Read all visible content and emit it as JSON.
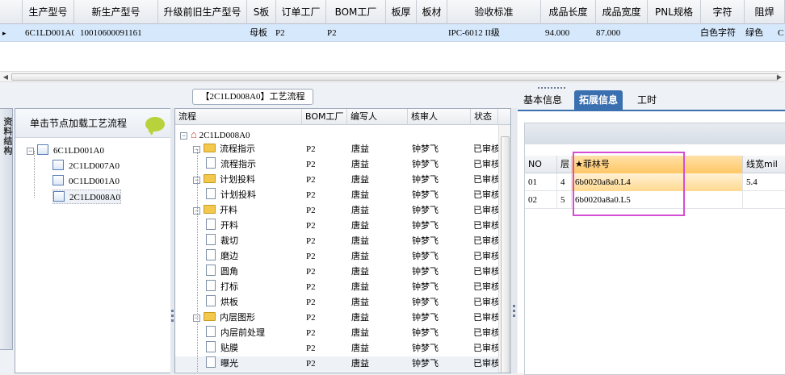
{
  "top_grid": {
    "columns": [
      "生产型号",
      "新生产型号",
      "升级前旧生产型号",
      "S板",
      "订单工厂",
      "BOM工厂",
      "板厚",
      "板材",
      "验收标准",
      "成品长度",
      "成品宽度",
      "PNL规格",
      "字符",
      "阻焊"
    ],
    "row": {
      "marker": "▸",
      "prod_model": "6C1LD001A0",
      "new_model": "10010600091161",
      "old_model": "",
      "s_board": "母板",
      "order_factory": "P2",
      "bom_factory": "P2",
      "thickness": "",
      "material": "",
      "standard": "IPC-6012 II级",
      "length": "94.000",
      "width": "87.000",
      "pnl": "",
      "char": "白色字符",
      "solder": "绿色",
      "extra": "C"
    }
  },
  "left_vertical_tab": "资料结构",
  "tree": {
    "header": "单击节点加载工艺流程",
    "root": "6C1LD001A0",
    "children": [
      "2C1LD007A0",
      "0C1LD001A0",
      "2C1LD008A0"
    ],
    "selected": "2C1LD008A0"
  },
  "flow": {
    "title": "【2C1LD008A0】工艺流程",
    "columns": [
      "流程",
      "BOM工厂",
      "编写人",
      "核审人",
      "状态"
    ],
    "root": "2C1LD008A0",
    "rows": [
      {
        "name": "流程指示",
        "level": 1,
        "folder": true,
        "bom": "P2",
        "writer": "唐益",
        "reviewer": "钟梦飞",
        "status": "已审核"
      },
      {
        "name": "流程指示",
        "level": 2,
        "folder": false,
        "bom": "P2",
        "writer": "唐益",
        "reviewer": "钟梦飞",
        "status": "已审核"
      },
      {
        "name": "计划投料",
        "level": 1,
        "folder": true,
        "bom": "P2",
        "writer": "唐益",
        "reviewer": "钟梦飞",
        "status": "已审核"
      },
      {
        "name": "计划投料",
        "level": 2,
        "folder": false,
        "bom": "P2",
        "writer": "唐益",
        "reviewer": "钟梦飞",
        "status": "已审核"
      },
      {
        "name": "开料",
        "level": 1,
        "folder": true,
        "bom": "P2",
        "writer": "唐益",
        "reviewer": "钟梦飞",
        "status": "已审核"
      },
      {
        "name": "开料",
        "level": 2,
        "folder": false,
        "bom": "P2",
        "writer": "唐益",
        "reviewer": "钟梦飞",
        "status": "已审核"
      },
      {
        "name": "裁切",
        "level": 2,
        "folder": false,
        "bom": "P2",
        "writer": "唐益",
        "reviewer": "钟梦飞",
        "status": "已审核"
      },
      {
        "name": "磨边",
        "level": 2,
        "folder": false,
        "bom": "P2",
        "writer": "唐益",
        "reviewer": "钟梦飞",
        "status": "已审核"
      },
      {
        "name": "圆角",
        "level": 2,
        "folder": false,
        "bom": "P2",
        "writer": "唐益",
        "reviewer": "钟梦飞",
        "status": "已审核"
      },
      {
        "name": "打标",
        "level": 2,
        "folder": false,
        "bom": "P2",
        "writer": "唐益",
        "reviewer": "钟梦飞",
        "status": "已审核"
      },
      {
        "name": "烘板",
        "level": 2,
        "folder": false,
        "bom": "P2",
        "writer": "唐益",
        "reviewer": "钟梦飞",
        "status": "已审核"
      },
      {
        "name": "内层图形",
        "level": 1,
        "folder": true,
        "bom": "P2",
        "writer": "唐益",
        "reviewer": "钟梦飞",
        "status": "已审核"
      },
      {
        "name": "内层前处理",
        "level": 2,
        "folder": false,
        "bom": "P2",
        "writer": "唐益",
        "reviewer": "钟梦飞",
        "status": "已审核"
      },
      {
        "name": "贴膜",
        "level": 2,
        "folder": false,
        "bom": "P2",
        "writer": "唐益",
        "reviewer": "钟梦飞",
        "status": "已审核"
      },
      {
        "name": "曝光",
        "level": 2,
        "folder": false,
        "bom": "P2",
        "writer": "唐益",
        "reviewer": "钟梦飞",
        "status": "已审核"
      }
    ]
  },
  "right": {
    "tabs": [
      "基本信息",
      "拓展信息",
      "工时"
    ],
    "active_tab": "拓展信息",
    "columns": [
      "NO",
      "层",
      "★菲林号",
      "线宽mil"
    ],
    "rows": [
      {
        "no": "01",
        "layer": "4",
        "film": "6b0020a8a0.L4",
        "width": "5.4"
      },
      {
        "no": "02",
        "layer": "5",
        "film": "6b0020a8a0.L5",
        "width": ""
      }
    ]
  },
  "colors": {
    "accent": "#3a6fb0",
    "highlight": "#d34ed3",
    "row_select": "#d6e8fb"
  }
}
